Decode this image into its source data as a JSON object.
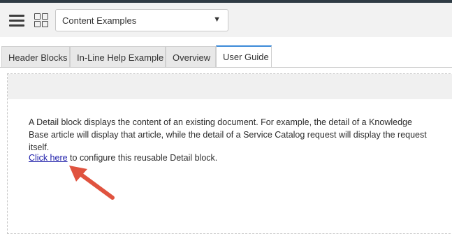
{
  "toolbar": {
    "menu_icon": "hamburger-menu-icon",
    "apps_icon": "grid-icon",
    "dropdown": {
      "selected": "Content Examples"
    }
  },
  "tabs": [
    {
      "label": "Header Blocks",
      "active": false
    },
    {
      "label": "In-Line Help Example",
      "active": false
    },
    {
      "label": "Overview",
      "active": false
    },
    {
      "label": "User Guide",
      "active": true
    }
  ],
  "content": {
    "description": "A Detail block displays the content of an existing document. For example, the detail of a Knowledge Base article will display that article, while the detail of a Service Catalog request will display the request itself.",
    "link_text": "Click here",
    "link_suffix": " to configure this reusable Detail block."
  },
  "annotation": {
    "arrow_color": "#e0533f"
  },
  "colors": {
    "link": "#1a1aa8",
    "active_tab_accent": "#3b8ad8"
  }
}
